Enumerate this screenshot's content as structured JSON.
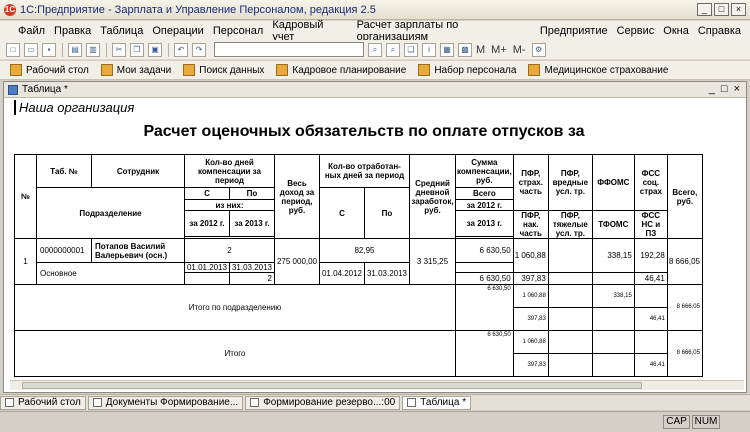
{
  "app": {
    "title": "1С:Предприятие - Зарплата и Управление Персоналом, редакция 2.5",
    "icon": "1c-logo-icon"
  },
  "window_buttons": [
    "_",
    "□",
    "×"
  ],
  "menu": [
    "Файл",
    "Правка",
    "Таблица",
    "Операции",
    "Персонал",
    "Кадровый учет",
    "Расчет зарплаты по организациям",
    "Предприятие",
    "Сервис",
    "Окна",
    "Справка"
  ],
  "toolbar": {
    "text": [
      "M",
      "M+",
      "M-"
    ]
  },
  "nav": [
    "Рабочий стол",
    "Мои задачи",
    "Поиск данных",
    "Кадровое планирование",
    "Набор персонала",
    "Медицинское страхование"
  ],
  "doc": {
    "title": "Таблица *",
    "buttons": [
      "_",
      "□",
      "×"
    ]
  },
  "sheet": {
    "org": "Наша организация",
    "title": "Расчет оценочных обязательств по оплате отпусков за",
    "h": {
      "num": "№",
      "tab": "Таб. №",
      "emp": "Сотрудник",
      "comp_days": "Кол-во дней компенсации за период",
      "from": "С",
      "to": "По",
      "of_them": "из них:",
      "y2012": "за 2012 г.",
      "y2013": "за 2013 г.",
      "total_income": "Весь доход за период, руб.",
      "worked_days": "Кол-во отработан-ных дней за период",
      "avg": "Средний дневной заработок, руб.",
      "comp_sum": "Сумма компенсации, руб.",
      "total": "Всего",
      "pfr_ins": "ПФР, страх. часть",
      "pfr_harm": "ПФР, вредные усл. тр.",
      "ffoms": "ФФОМС",
      "fss": "ФСС соц. страх",
      "total_rub": "Всего, руб.",
      "dept": "Подразделение",
      "pfr_acc": "ПФР, нак. часть",
      "pfr_heavy": "ПФР, тяжелые усл. тр.",
      "tfoms": "ТФОМС",
      "fss_ns": "ФСС НС и ПЗ"
    },
    "row": {
      "num": "1",
      "tab": "0000000001",
      "emp": "Потапов Василий Валерьевич (осн.)",
      "days": "2",
      "date_from": "01.01.2013",
      "date_to": "31.03.2013",
      "days_2013": "2",
      "income": "275 000,00",
      "worked": "82,95",
      "work_from": "01.04.2012",
      "work_to": "31.03.2013",
      "avg": "3 315,25",
      "comp_total": "6 630,50",
      "comp_2012": "",
      "comp_2013": "6 630,50",
      "pfr_ins": "1 060,88",
      "pfr_acc": "397,83",
      "ffoms": "338,15",
      "fss": "192,28",
      "fss_ns": "46,41",
      "total_rub": "8 666,05",
      "dept": "Основное"
    },
    "dept_total": {
      "label": "Итого по подразделению",
      "comp": "6 630,50",
      "pfr_ins": "1 060,88",
      "pfr_acc": "397,83",
      "ffoms": "338,15",
      "fss_ns": "46,41",
      "total": "8 666,05"
    },
    "grand_total": {
      "label": "Итого",
      "comp": "6 630,50",
      "pfr_ins": "1 060,88",
      "pfr_acc": "397,83",
      "fss_ns": "46,41",
      "total": "8 666,05"
    }
  },
  "taskbar": [
    "Рабочий стол",
    "Документы Формирование...",
    "Формирование резерво...:00",
    "Таблица *"
  ],
  "status": {
    "cap": "CAP",
    "num": "NUM"
  }
}
